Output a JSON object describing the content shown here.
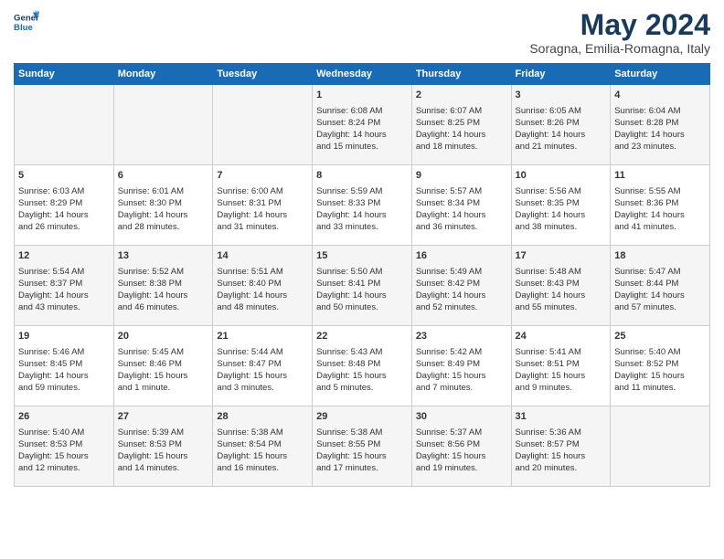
{
  "logo": {
    "line1": "General",
    "line2": "Blue"
  },
  "title": "May 2024",
  "subtitle": "Soragna, Emilia-Romagna, Italy",
  "days_of_week": [
    "Sunday",
    "Monday",
    "Tuesday",
    "Wednesday",
    "Thursday",
    "Friday",
    "Saturday"
  ],
  "weeks": [
    [
      {
        "day": "",
        "text": ""
      },
      {
        "day": "",
        "text": ""
      },
      {
        "day": "",
        "text": ""
      },
      {
        "day": "1",
        "text": "Sunrise: 6:08 AM\nSunset: 8:24 PM\nDaylight: 14 hours\nand 15 minutes."
      },
      {
        "day": "2",
        "text": "Sunrise: 6:07 AM\nSunset: 8:25 PM\nDaylight: 14 hours\nand 18 minutes."
      },
      {
        "day": "3",
        "text": "Sunrise: 6:05 AM\nSunset: 8:26 PM\nDaylight: 14 hours\nand 21 minutes."
      },
      {
        "day": "4",
        "text": "Sunrise: 6:04 AM\nSunset: 8:28 PM\nDaylight: 14 hours\nand 23 minutes."
      }
    ],
    [
      {
        "day": "5",
        "text": "Sunrise: 6:03 AM\nSunset: 8:29 PM\nDaylight: 14 hours\nand 26 minutes."
      },
      {
        "day": "6",
        "text": "Sunrise: 6:01 AM\nSunset: 8:30 PM\nDaylight: 14 hours\nand 28 minutes."
      },
      {
        "day": "7",
        "text": "Sunrise: 6:00 AM\nSunset: 8:31 PM\nDaylight: 14 hours\nand 31 minutes."
      },
      {
        "day": "8",
        "text": "Sunrise: 5:59 AM\nSunset: 8:33 PM\nDaylight: 14 hours\nand 33 minutes."
      },
      {
        "day": "9",
        "text": "Sunrise: 5:57 AM\nSunset: 8:34 PM\nDaylight: 14 hours\nand 36 minutes."
      },
      {
        "day": "10",
        "text": "Sunrise: 5:56 AM\nSunset: 8:35 PM\nDaylight: 14 hours\nand 38 minutes."
      },
      {
        "day": "11",
        "text": "Sunrise: 5:55 AM\nSunset: 8:36 PM\nDaylight: 14 hours\nand 41 minutes."
      }
    ],
    [
      {
        "day": "12",
        "text": "Sunrise: 5:54 AM\nSunset: 8:37 PM\nDaylight: 14 hours\nand 43 minutes."
      },
      {
        "day": "13",
        "text": "Sunrise: 5:52 AM\nSunset: 8:38 PM\nDaylight: 14 hours\nand 46 minutes."
      },
      {
        "day": "14",
        "text": "Sunrise: 5:51 AM\nSunset: 8:40 PM\nDaylight: 14 hours\nand 48 minutes."
      },
      {
        "day": "15",
        "text": "Sunrise: 5:50 AM\nSunset: 8:41 PM\nDaylight: 14 hours\nand 50 minutes."
      },
      {
        "day": "16",
        "text": "Sunrise: 5:49 AM\nSunset: 8:42 PM\nDaylight: 14 hours\nand 52 minutes."
      },
      {
        "day": "17",
        "text": "Sunrise: 5:48 AM\nSunset: 8:43 PM\nDaylight: 14 hours\nand 55 minutes."
      },
      {
        "day": "18",
        "text": "Sunrise: 5:47 AM\nSunset: 8:44 PM\nDaylight: 14 hours\nand 57 minutes."
      }
    ],
    [
      {
        "day": "19",
        "text": "Sunrise: 5:46 AM\nSunset: 8:45 PM\nDaylight: 14 hours\nand 59 minutes."
      },
      {
        "day": "20",
        "text": "Sunrise: 5:45 AM\nSunset: 8:46 PM\nDaylight: 15 hours\nand 1 minute."
      },
      {
        "day": "21",
        "text": "Sunrise: 5:44 AM\nSunset: 8:47 PM\nDaylight: 15 hours\nand 3 minutes."
      },
      {
        "day": "22",
        "text": "Sunrise: 5:43 AM\nSunset: 8:48 PM\nDaylight: 15 hours\nand 5 minutes."
      },
      {
        "day": "23",
        "text": "Sunrise: 5:42 AM\nSunset: 8:49 PM\nDaylight: 15 hours\nand 7 minutes."
      },
      {
        "day": "24",
        "text": "Sunrise: 5:41 AM\nSunset: 8:51 PM\nDaylight: 15 hours\nand 9 minutes."
      },
      {
        "day": "25",
        "text": "Sunrise: 5:40 AM\nSunset: 8:52 PM\nDaylight: 15 hours\nand 11 minutes."
      }
    ],
    [
      {
        "day": "26",
        "text": "Sunrise: 5:40 AM\nSunset: 8:53 PM\nDaylight: 15 hours\nand 12 minutes."
      },
      {
        "day": "27",
        "text": "Sunrise: 5:39 AM\nSunset: 8:53 PM\nDaylight: 15 hours\nand 14 minutes."
      },
      {
        "day": "28",
        "text": "Sunrise: 5:38 AM\nSunset: 8:54 PM\nDaylight: 15 hours\nand 16 minutes."
      },
      {
        "day": "29",
        "text": "Sunrise: 5:38 AM\nSunset: 8:55 PM\nDaylight: 15 hours\nand 17 minutes."
      },
      {
        "day": "30",
        "text": "Sunrise: 5:37 AM\nSunset: 8:56 PM\nDaylight: 15 hours\nand 19 minutes."
      },
      {
        "day": "31",
        "text": "Sunrise: 5:36 AM\nSunset: 8:57 PM\nDaylight: 15 hours\nand 20 minutes."
      },
      {
        "day": "",
        "text": ""
      }
    ]
  ],
  "colors": {
    "header_bg": "#1a6bb5",
    "header_text": "#ffffff",
    "title_color": "#1a3a5c",
    "odd_row": "#f5f5f5",
    "even_row": "#ffffff"
  }
}
